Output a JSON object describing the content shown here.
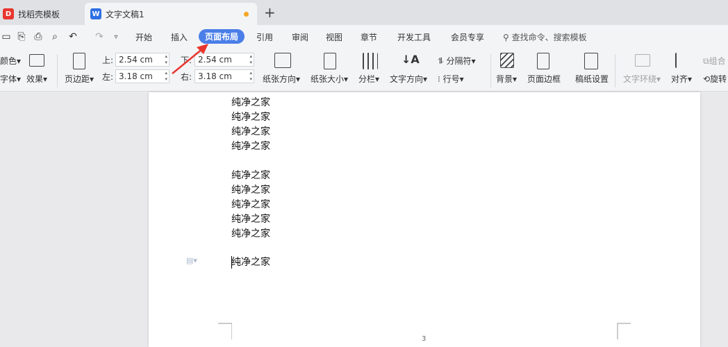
{
  "tabs": [
    {
      "label": "找稻壳模板",
      "icon": "docer-icon",
      "color": "#e8362f"
    },
    {
      "label": "文字文稿1",
      "icon": "wps-writer-icon",
      "color": "#2f6fe4"
    }
  ],
  "menu": {
    "items": [
      "开始",
      "插入",
      "页面布局",
      "引用",
      "审阅",
      "视图",
      "章节",
      "开发工具",
      "会员专享"
    ],
    "active": "页面布局",
    "search_placeholder": "查找命令、搜索模板"
  },
  "ribbon": {
    "theme_color": "颜色",
    "font": "字体",
    "effect": "效果",
    "margins": "页边距",
    "top_label": "上:",
    "top_value": "2.54 cm",
    "bottom_label": "下:",
    "bottom_value": "2.54 cm",
    "left_label": "左:",
    "left_value": "3.18 cm",
    "right_label": "右:",
    "right_value": "3.18 cm",
    "orientation": "纸张方向",
    "size": "纸张大小",
    "columns": "分栏",
    "text_direction": "文字方向",
    "break": "分隔符",
    "line_numbers": "行号",
    "background": "背景",
    "page_border": "页面边框",
    "manuscript": "稿纸设置",
    "wrap": "文字环绕",
    "align": "对齐",
    "group": "组合",
    "rotate": "旋转"
  },
  "document": {
    "lines": [
      "纯净之家",
      "纯净之家",
      "纯净之家",
      "纯净之家",
      "",
      "纯净之家",
      "纯净之家",
      "纯净之家",
      "纯净之家",
      "纯净之家",
      "",
      "纯净之家"
    ],
    "page_number": "3"
  },
  "colors": {
    "accent": "#4a7ee8",
    "arrow": "#e8362f"
  }
}
